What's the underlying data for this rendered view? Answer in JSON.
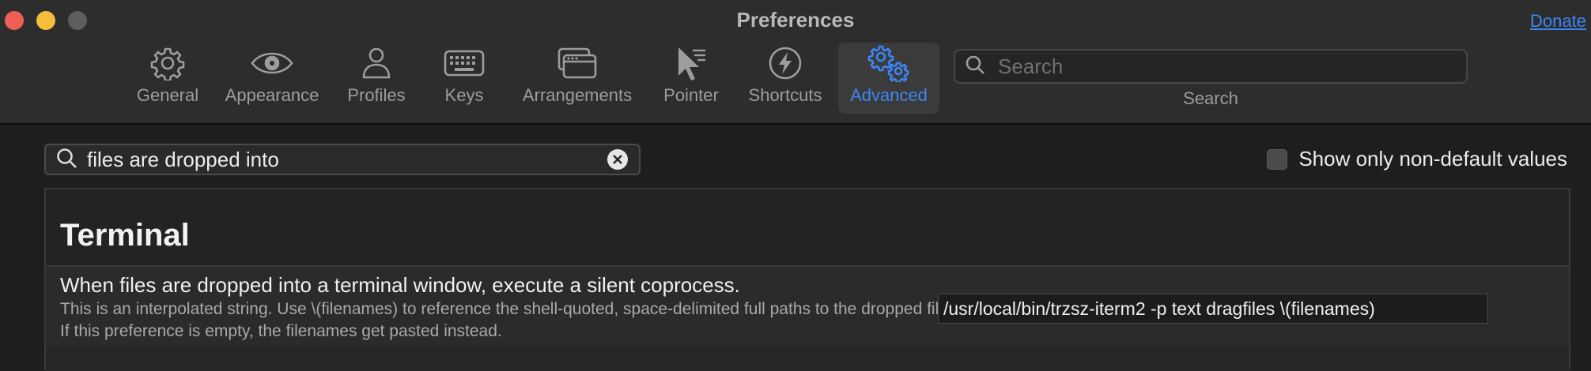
{
  "window": {
    "title": "Preferences",
    "donate_label": "Donate"
  },
  "tabs": [
    {
      "label": "General",
      "icon": "gear-icon"
    },
    {
      "label": "Appearance",
      "icon": "eye-icon"
    },
    {
      "label": "Profiles",
      "icon": "person-icon"
    },
    {
      "label": "Keys",
      "icon": "keyboard-icon"
    },
    {
      "label": "Arrangements",
      "icon": "windows-icon"
    },
    {
      "label": "Pointer",
      "icon": "pointer-icon"
    },
    {
      "label": "Shortcuts",
      "icon": "lightning-icon"
    },
    {
      "label": "Advanced",
      "icon": "gears-icon",
      "selected": true
    }
  ],
  "toolbar_search": {
    "placeholder": "Search",
    "caption": "Search"
  },
  "filter": {
    "value": "files are dropped into",
    "show_nondefault_label": "Show only non-default values",
    "show_nondefault_checked": false
  },
  "section": {
    "title": "Terminal",
    "settings": [
      {
        "title": "When files are dropped into a terminal window, execute a silent coprocess.",
        "description": "This is an interpolated string. Use \\(filenames) to reference the shell-quoted, space-delimited full paths to the dropped files. If this preference is empty, the filenames get pasted instead.",
        "value": "/usr/local/bin/trzsz-iterm2 -p text dragfiles \\(filenames)"
      }
    ]
  },
  "colors": {
    "accent": "#3b86f7",
    "close": "#ee5f58",
    "minimize": "#f6bd3a"
  }
}
